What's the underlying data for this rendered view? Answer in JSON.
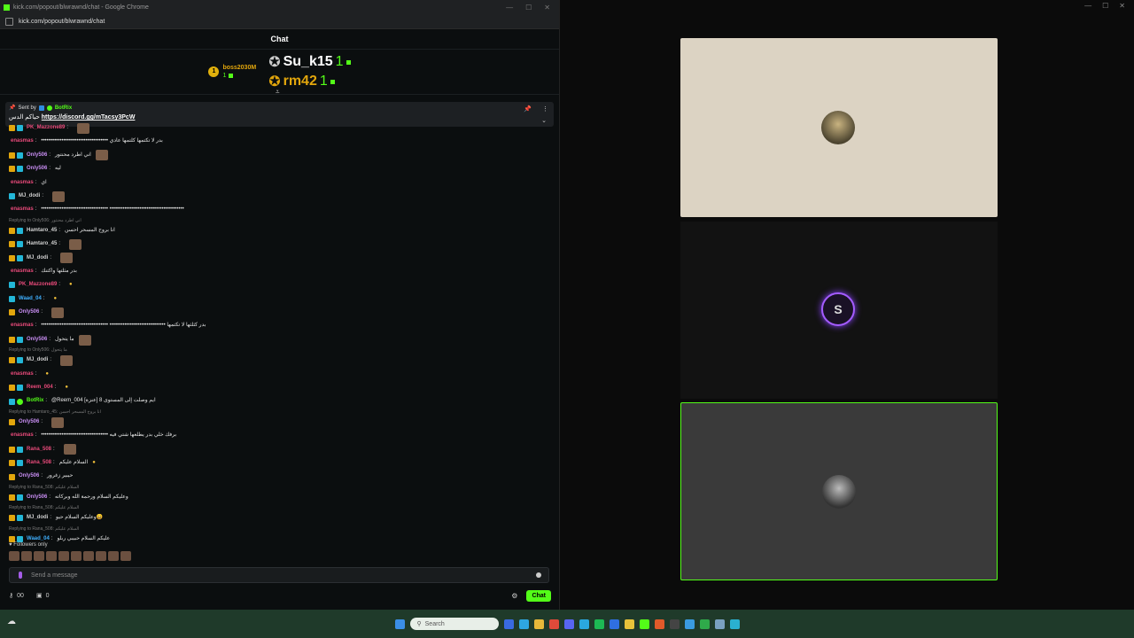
{
  "browser": {
    "title": "kick.com/popout/blwrawnd/chat - Google Chrome",
    "url": "kick.com/popout/blwrawnd/chat",
    "window_controls": [
      "—",
      "☐",
      "✕"
    ]
  },
  "chat": {
    "header": "Chat",
    "gifters": [
      {
        "name": "boss2030M",
        "count": "1"
      },
      {
        "name": "Su_k15",
        "count": "1"
      },
      {
        "name": "rm42",
        "count": "1"
      }
    ],
    "pinned": {
      "sent_by_label": "Sent by",
      "sender": "BotRix",
      "text_prefix": "حياكم الدس",
      "link": "https://discord.gg/mTacsy3PcW"
    },
    "messages": [
      {
        "user": "PK_Mazzone89",
        "color": "#e84a7a",
        "text": "",
        "badges": [
          "or",
          "bl"
        ],
        "emote": true
      },
      {
        "user": "enasmas",
        "color": "#e84a7a",
        "text": "•••••••••••••••••••••••••••••••••••• بدر لا تكتمها كلتمها عادي"
      },
      {
        "user": "Only506",
        "color": "#c68cf0",
        "text": "اني اطرد محنتور",
        "badges": [
          "or",
          "bl"
        ],
        "emote": true
      },
      {
        "user": "Only506",
        "color": "#c68cf0",
        "text": "ليه",
        "badges": [
          "or",
          "bl"
        ]
      },
      {
        "user": "enasmas",
        "color": "#e84a7a",
        "text": "اي"
      },
      {
        "user": "MJ_dodi",
        "color": "#cfcfcf",
        "text": "",
        "badges": [
          "bl"
        ],
        "emote": true
      },
      {
        "user": "enasmas",
        "color": "#e84a7a",
        "text": "•••••••••••••••••••••••••••••••••••• ••••••••••••••••••••••••••••••••••••••••"
      },
      {
        "reply": "Replying to Only506: اني اطرد محنتور"
      },
      {
        "user": "Hamtaro_45",
        "color": "#cfcfcf",
        "text": "انا بروح المسحر احسن",
        "badges": [
          "or",
          "bl"
        ]
      },
      {
        "user": "Hamtaro_45",
        "color": "#cfcfcf",
        "text": "",
        "badges": [
          "or",
          "bl"
        ],
        "emote": true
      },
      {
        "user": "MJ_dodi",
        "color": "#cfcfcf",
        "text": "",
        "badges": [
          "or",
          "bl"
        ],
        "emote": true
      },
      {
        "user": "enasmas",
        "color": "#e84a7a",
        "text": "بدر مثلتها واكتنك"
      },
      {
        "user": "PK_Mazzone89",
        "color": "#e84a7a",
        "text": "",
        "badges": [
          "bl"
        ],
        "emoji": true
      },
      {
        "user": "Waad_04",
        "color": "#3fb0ff",
        "text": "",
        "badges": [
          "bl"
        ],
        "emoji": true
      },
      {
        "user": "Only506",
        "color": "#c68cf0",
        "text": "",
        "badges": [
          "or"
        ],
        "emote": true
      },
      {
        "user": "enasmas",
        "color": "#e84a7a",
        "text": "•••••••••••••••••••••••••••••••••••• •••••••••••••••••••••••••••••• بدر كثلثها لا تكتمها"
      },
      {
        "user": "Only506",
        "color": "#c68cf0",
        "text": "ما يتحول",
        "badges": [
          "or",
          "bl"
        ],
        "emote": true
      },
      {
        "reply": "Replying to Only506: ما يتحول"
      },
      {
        "user": "MJ_dodi",
        "color": "#cfcfcf",
        "text": "",
        "badges": [
          "or",
          "bl"
        ],
        "emote": true
      },
      {
        "user": "enasmas",
        "color": "#e84a7a",
        "text": "",
        "emoji": true
      },
      {
        "user": "Reem_004",
        "color": "#e84a7a",
        "text": "",
        "badges": [
          "or",
          "bl"
        ],
        "emoji": true
      },
      {
        "user": "BotRix",
        "color": "#53fc18",
        "text": "@Reem_004 ايم وصلت إلى المستوى 8 [عنزة]",
        "badges": [
          "bl",
          "gr"
        ]
      },
      {
        "reply": "Replying to Hamtaro_45: انا بروح المسحر احسن"
      },
      {
        "user": "Only506",
        "color": "#c68cf0",
        "text": "",
        "badges": [
          "or"
        ],
        "emote": true
      },
      {
        "user": "enasmas",
        "color": "#e84a7a",
        "text": "•••••••••••••••••••••••••••••••••••• برفك خلي بدر يطلعها شتي فيه"
      },
      {
        "user": "Rana_508",
        "color": "#e84a7a",
        "text": "",
        "badges": [
          "or",
          "bl"
        ],
        "emote": true
      },
      {
        "user": "Rana_508",
        "color": "#e84a7a",
        "text": "السلام عليكم",
        "badges": [
          "or",
          "bl"
        ],
        "emoji": true
      },
      {
        "user": "Only506",
        "color": "#c68cf0",
        "text": "حيبير زغرور",
        "badges": [
          "or"
        ]
      },
      {
        "reply": "Replying to Rana_508: السلام عليكم"
      },
      {
        "user": "Only506",
        "color": "#c68cf0",
        "text": "وعليكم السلام ورحمة الله وبركاته",
        "badges": [
          "or",
          "bl"
        ]
      },
      {
        "reply": "Replying to Rana_508: السلام عليكم"
      },
      {
        "user": "MJ_dodi",
        "color": "#cfcfcf",
        "text": "وعليكم السلام حيو😄",
        "badges": [
          "or",
          "bl"
        ]
      },
      {
        "reply": "Replying to Rana_508: السلام عليكم"
      },
      {
        "user": "Waad_04",
        "color": "#3fb0ff",
        "text": "عليكم السلام حبيبي ربلو",
        "badges": [
          "or",
          "bl"
        ]
      }
    ],
    "followers_only": "Followers only",
    "input_placeholder": "Send a message",
    "viewer_count": "00",
    "points": "0",
    "chat_button": "Chat"
  },
  "taskbar": {
    "search_placeholder": "Search"
  },
  "accent_color": "#53fc18"
}
